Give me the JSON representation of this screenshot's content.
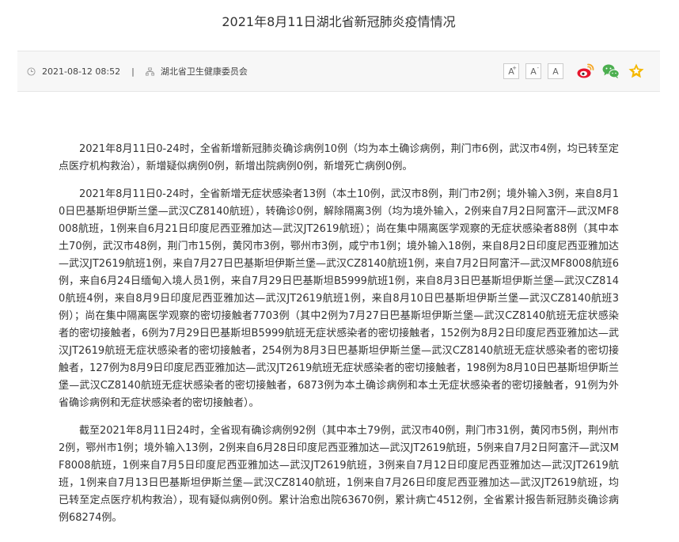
{
  "article": {
    "title": "2021年8月11日湖北省新冠肺炎疫情情况",
    "date": "2021-08-12 08:52",
    "separator": "|",
    "source": "湖北省卫生健康委员会",
    "font_sizes": [
      "A",
      "A",
      "A"
    ],
    "font_size_superscripts": [
      "+",
      "-"
    ],
    "paragraphs": [
      "2021年8月11日0-24时，全省新增新冠肺炎确诊病例10例（均为本土确诊病例，荆门市6例，武汉市4例，均已转至定点医疗机构救治），新增疑似病例0例，新增出院病例0例，新增死亡病例0例。",
      "2021年8月11日0-24时，全省新增无症状感染者13例（本土10例，武汉市8例，荆门市2例；境外输入3例，来自8月10日巴基斯坦伊斯兰堡—武汉CZ8140航班），转确诊0例，解除隔离3例（均为境外输入，2例来自7月2日阿富汗—武汉MF8008航班，1例来自6月21日印度尼西亚雅加达—武汉JT2619航班）；尚在集中隔离医学观察的无症状感染者88例（其中本土70例，武汉市48例，荆门市15例，黄冈市3例，鄂州市3例，咸宁市1例；境外输入18例，来自8月2日印度尼西亚雅加达—武汉JT2619航班1例，来自7月27日巴基斯坦伊斯兰堡—武汉CZ8140航班1例，来自7月2日阿富汗—武汉MF8008航班6例，来自6月24日缅甸入境人员1例，来自7月29日巴基斯坦B5999航班1例，来自8月3日巴基斯坦伊斯兰堡—武汉CZ8140航班4例，来自8月9日印度尼西亚雅加达—武汉JT2619航班1例，来自8月10日巴基斯坦伊斯兰堡—武汉CZ8140航班3例）；尚在集中隔离医学观察的密切接触者7703例（其中2例为7月27日巴基斯坦伊斯兰堡—武汉CZ8140航班无症状感染者的密切接触者，6例为7月29日巴基斯坦B5999航班无症状感染者的密切接触者，152例为8月2日印度尼西亚雅加达—武汉JT2619航班无症状感染者的密切接触者，254例为8月3日巴基斯坦伊斯兰堡—武汉CZ8140航班无症状感染者的密切接触者，127例为8月9日印度尼西亚雅加达—武汉JT2619航班无症状感染者的密切接触者，198例为8月10日巴基斯坦伊斯兰堡—武汉CZ8140航班无症状感染者的密切接触者，6873例为本土确诊病例和本土无症状感染者的密切接触者，91例为外省确诊病例和无症状感染者的密切接触者）。",
      "截至2021年8月11日24时，全省现有确诊病例92例（其中本土79例，武汉市40例，荆门市31例，黄冈市5例，荆州市2例，鄂州市1例；境外输入13例，2例来自6月28日印度尼西亚雅加达—武汉JT2619航班，5例来自7月2日阿富汗—武汉MF8008航班，1例来自7月5日印度尼西亚雅加达—武汉JT2619航班，3例来自7月12日印度尼西亚雅加达—武汉JT2619航班，1例来自7月13日巴基斯坦伊斯兰堡—武汉CZ8140航班，1例来自7月26日印度尼西亚雅加达—武汉JT2619航班，均已转至定点医疗机构救治），现有疑似病例0例。累计治愈出院63670例，累计病亡4512例，全省累计报告新冠肺炎确诊病例68274例。"
    ]
  },
  "icons": {
    "clock": "clock-icon",
    "source": "org-icon",
    "weibo": "weibo-icon",
    "wechat": "wechat-icon",
    "favorite": "star-icon"
  },
  "colors": {
    "weibo": "#e6162d",
    "weibo_eye": "#f5a623",
    "wechat": "#4caf50",
    "star": "#f5b800",
    "meta_bg": "#f7f7f7"
  }
}
